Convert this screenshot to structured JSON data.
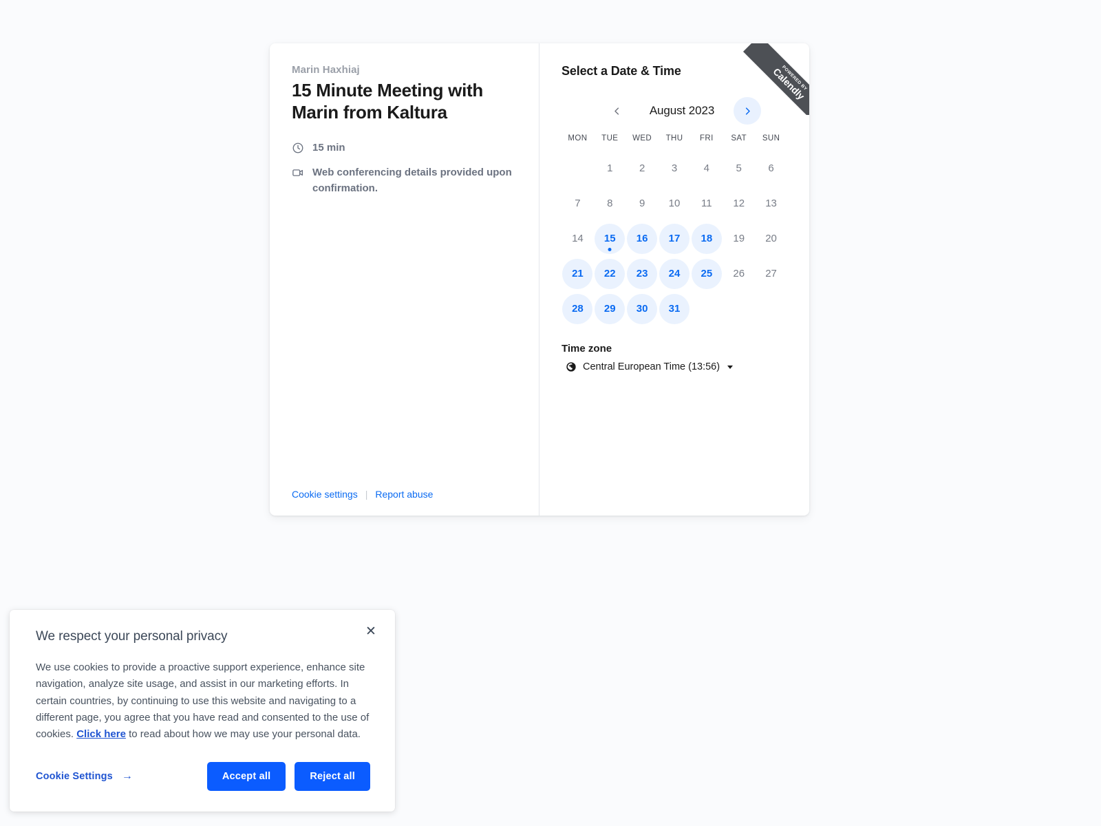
{
  "page": {
    "background_color": "#fafbfd"
  },
  "booking": {
    "host_name": "Marin Haxhiaj",
    "event_title": "15 Minute Meeting with Marin from Kaltura",
    "duration": "15 min",
    "location": "Web conferencing details provided upon confirmation.",
    "footer": {
      "cookie_settings": "Cookie settings",
      "separator": "|",
      "report_abuse": "Report abuse"
    }
  },
  "ribbon": {
    "small_text": "POWERED BY",
    "big_text": "Calendly",
    "background_color": "#4d5055"
  },
  "scheduler": {
    "title": "Select a Date & Time",
    "month_label": "August 2023",
    "prev_label": "Previous month",
    "next_label": "Next month",
    "weekdays": [
      "MON",
      "TUE",
      "WED",
      "THU",
      "FRI",
      "SAT",
      "SUN"
    ],
    "accent_color": "#0b6bf2",
    "available_bg_color": "#eaf2fe",
    "weeks": [
      [
        {
          "day": "",
          "available": false,
          "empty": true
        },
        {
          "day": "1",
          "available": false
        },
        {
          "day": "2",
          "available": false
        },
        {
          "day": "3",
          "available": false
        },
        {
          "day": "4",
          "available": false
        },
        {
          "day": "5",
          "available": false
        },
        {
          "day": "6",
          "available": false
        }
      ],
      [
        {
          "day": "7",
          "available": false
        },
        {
          "day": "8",
          "available": false
        },
        {
          "day": "9",
          "available": false
        },
        {
          "day": "10",
          "available": false
        },
        {
          "day": "11",
          "available": false
        },
        {
          "day": "12",
          "available": false
        },
        {
          "day": "13",
          "available": false
        }
      ],
      [
        {
          "day": "14",
          "available": false
        },
        {
          "day": "15",
          "available": true,
          "today": true
        },
        {
          "day": "16",
          "available": true
        },
        {
          "day": "17",
          "available": true
        },
        {
          "day": "18",
          "available": true
        },
        {
          "day": "19",
          "available": false
        },
        {
          "day": "20",
          "available": false
        }
      ],
      [
        {
          "day": "21",
          "available": true
        },
        {
          "day": "22",
          "available": true
        },
        {
          "day": "23",
          "available": true
        },
        {
          "day": "24",
          "available": true
        },
        {
          "day": "25",
          "available": true
        },
        {
          "day": "26",
          "available": false
        },
        {
          "day": "27",
          "available": false
        }
      ],
      [
        {
          "day": "28",
          "available": true
        },
        {
          "day": "29",
          "available": true
        },
        {
          "day": "30",
          "available": true
        },
        {
          "day": "31",
          "available": true
        },
        {
          "day": "",
          "available": false,
          "empty": true
        },
        {
          "day": "",
          "available": false,
          "empty": true
        },
        {
          "day": "",
          "available": false,
          "empty": true
        }
      ]
    ],
    "timezone": {
      "label": "Time zone",
      "value": "Central European Time (13:56)"
    }
  },
  "cookie_banner": {
    "heading": "We respect your personal privacy",
    "body_part1": "We use cookies to provide a proactive support experience, enhance site navigation, analyze site usage, and assist in our marketing efforts. In certain countries, by continuing to use this website and navigating to a different page, you agree that you have read and consented to the use of cookies. ",
    "link_text": "Click here",
    "body_part2": " to read about how we may use your personal data.",
    "settings_label": "Cookie Settings",
    "settings_arrow": "→",
    "accept_label": "Accept all",
    "reject_label": "Reject all",
    "close_label": "✕",
    "button_color": "#0b5cff",
    "link_color": "#1f54d1"
  }
}
